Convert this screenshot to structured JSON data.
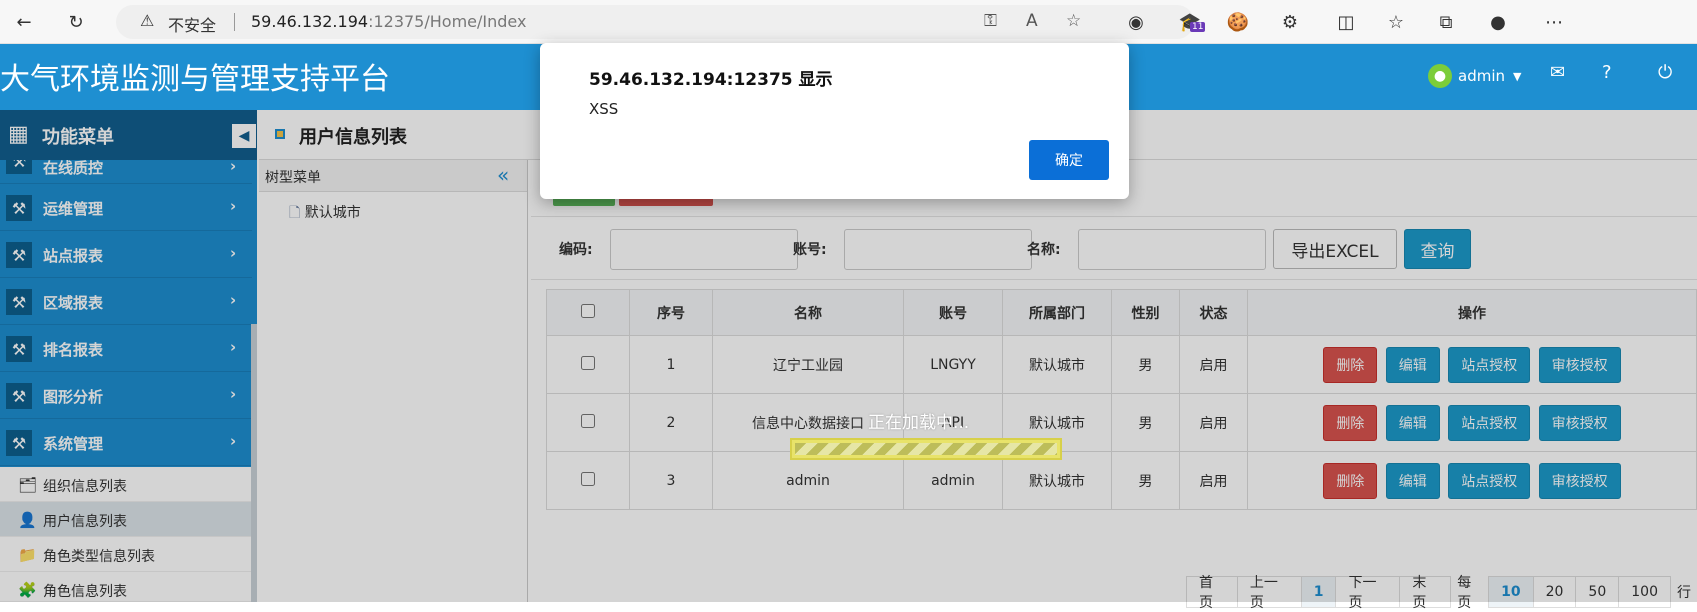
{
  "browser": {
    "not_secure": "不安全",
    "url_host": "59.46.132.194",
    "url_rest": ":12375/Home/Index",
    "badge_count": "11"
  },
  "header": {
    "title": "大气环境监测与管理支持平台",
    "user": "admin"
  },
  "sidebar": {
    "menu_title": "功能菜单",
    "items": [
      {
        "label": "在线质控"
      },
      {
        "label": "运维管理"
      },
      {
        "label": "站点报表"
      },
      {
        "label": "区域报表"
      },
      {
        "label": "排名报表"
      },
      {
        "label": "图形分析"
      },
      {
        "label": "系统管理"
      }
    ],
    "subitems": [
      {
        "label": "组织信息列表"
      },
      {
        "label": "用户信息列表"
      },
      {
        "label": "角色类型信息列表"
      },
      {
        "label": "角色信息列表"
      }
    ]
  },
  "tab": {
    "label": "用户信息列表"
  },
  "tree": {
    "title": "树型菜单",
    "node": "默认城市"
  },
  "filters": {
    "code_label": "编码:",
    "account_label": "账号:",
    "name_label": "名称:",
    "export_button": "导出EXCEL",
    "search_button": "查询"
  },
  "table": {
    "headers": [
      "序号",
      "名称",
      "账号",
      "所属部门",
      "性别",
      "状态",
      "操作"
    ],
    "rows": [
      {
        "no": "1",
        "name": "辽宁工业园",
        "account": "LNGYY",
        "dept": "默认城市",
        "gender": "男",
        "status": "启用"
      },
      {
        "no": "2",
        "name": "信息中心数据接口",
        "account": "API",
        "dept": "默认城市",
        "gender": "男",
        "status": "启用"
      },
      {
        "no": "3",
        "name": "admin",
        "account": "admin",
        "dept": "默认城市",
        "gender": "男",
        "status": "启用"
      }
    ],
    "actions": {
      "delete": "删除",
      "edit": "编辑",
      "site_auth": "站点授权",
      "review_auth": "审核授权"
    }
  },
  "pager": {
    "first": "首页",
    "prev": "上一页",
    "current": "1",
    "next": "下一页",
    "last": "末页",
    "per_page": "每页",
    "sizes": [
      "10",
      "20",
      "50",
      "100"
    ],
    "rows_suffix": "行"
  },
  "loading": {
    "text": "正在加载中..."
  },
  "dialog": {
    "title": "59.46.132.194:12375 显示",
    "message": "XSS",
    "ok": "确定"
  },
  "colors": {
    "brand": "#1e8fd1",
    "danger": "#d9534f",
    "info": "#1c9acb",
    "dialog_button": "#0b6fd7"
  }
}
